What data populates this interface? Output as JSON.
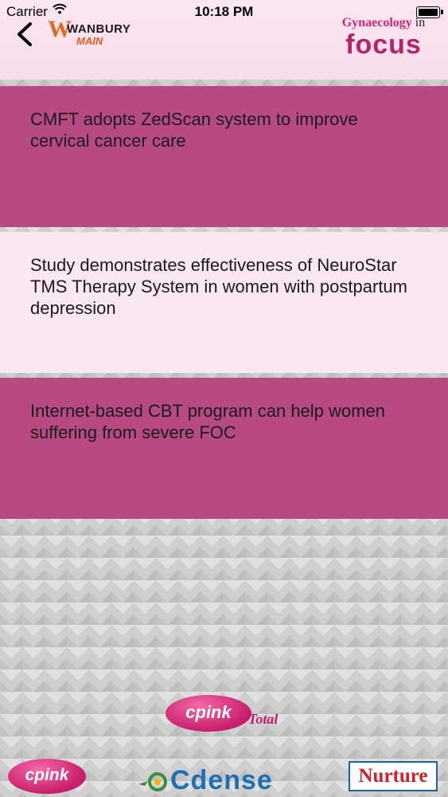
{
  "status_bar": {
    "carrier": "Carrier",
    "time": "10:18 PM",
    "battery_level": 1.0
  },
  "header": {
    "back_icon": "chevron-left-icon",
    "left_logo": {
      "mark": "W",
      "name": "WANBURY",
      "sub": "MAIN"
    },
    "right_logo": {
      "line1": "Gynaecology",
      "line1_suffix": "in",
      "line2": "focus"
    }
  },
  "articles": [
    {
      "title": "CMFT adopts ZedScan system to improve cervical cancer care",
      "style": "dark"
    },
    {
      "title": "Study demonstrates effectiveness of NeuroStar TMS Therapy System in women with postpartum depression",
      "style": "light"
    },
    {
      "title": "Internet-based CBT program can help women suffering from severe FOC",
      "style": "dark"
    }
  ],
  "footer_logos": {
    "cpink_total": {
      "pill": "cpink",
      "suffix": "Total"
    },
    "cpink": "cpink",
    "cdense": "Cdense",
    "nurture": "Nurture"
  },
  "colors": {
    "dark_row": "#b84a83",
    "light_row": "#fbe7f2",
    "header_bg": "#f7dcea",
    "accent": "#b8226a"
  }
}
